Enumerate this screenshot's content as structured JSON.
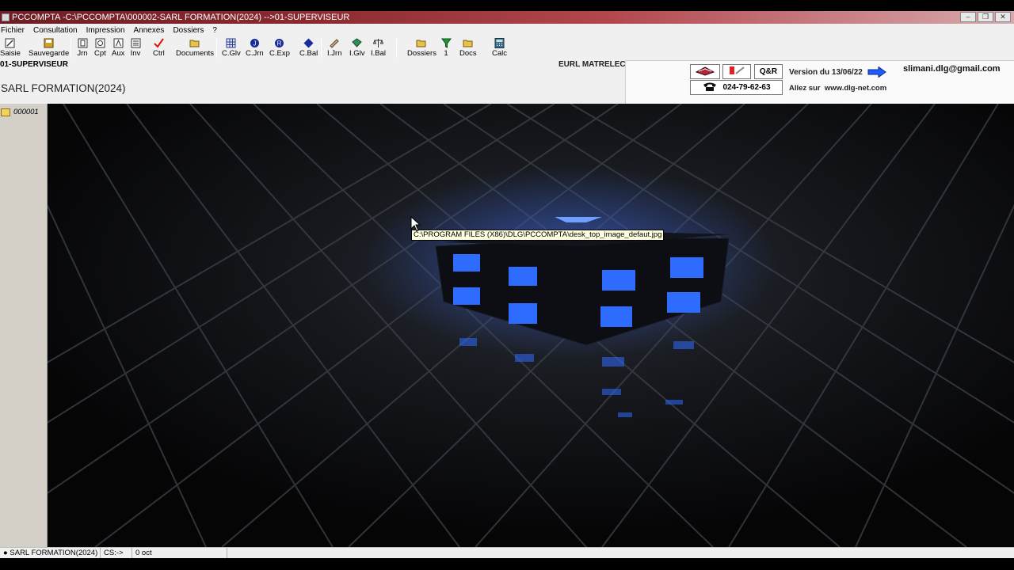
{
  "window": {
    "title": "PCCOMPTA -C:\\PCCOMPTA\\000002-SARL FORMATION(2024) -->01-SUPERVISEUR",
    "controls": [
      "minimize",
      "restore",
      "close"
    ]
  },
  "menu": [
    "Fichier",
    "Consultation",
    "Impression",
    "Annexes",
    "Dossiers",
    "?"
  ],
  "toolbar": {
    "items": [
      {
        "label": "Saisie",
        "icon": "pen-icon"
      },
      {
        "label": "Sauvegarde",
        "icon": "disk-icon"
      },
      {
        "label": "Jrn",
        "icon": "journal-icon"
      },
      {
        "label": "Cpt",
        "icon": "account-icon"
      },
      {
        "label": "Aux",
        "icon": "auxiliary-icon"
      },
      {
        "label": "Inv",
        "icon": "inventory-icon"
      },
      {
        "label": "Ctrl",
        "icon": "checkmark-icon"
      },
      {
        "label": "Documents",
        "icon": "folder-open-icon"
      },
      {
        "label": "C.Glv",
        "icon": "grid-icon"
      },
      {
        "label": "C.Jrn",
        "icon": "circle-j-icon"
      },
      {
        "label": "C.Exp",
        "icon": "circle-r-icon"
      },
      {
        "label": "C.Bal",
        "icon": "diamond-icon"
      },
      {
        "label": "I.Jrn",
        "icon": "pencil-icon"
      },
      {
        "label": "I.Glv",
        "icon": "book-icon"
      },
      {
        "label": "I.Bal",
        "icon": "scales-icon"
      },
      {
        "label": "Dossiers",
        "icon": "folder-open-icon"
      },
      {
        "label": "1",
        "icon": "funnel-icon"
      },
      {
        "label": "Docs",
        "icon": "folder-open-icon"
      },
      {
        "label": "Calc",
        "icon": "calculator-icon"
      }
    ]
  },
  "header": {
    "user": "01-SUPERVISEUR",
    "company": "SARL FORMATION(2024)",
    "client": "EURL MATRELEC",
    "qr_label": "Q&R",
    "phone": "024-79-62-63",
    "version": "Version du 13/06/22",
    "email": "slimani.dlg@gmail.com",
    "visit_prefix": "Allez sur",
    "website": "www.dlg-net.com"
  },
  "sidebar": {
    "folder_label": "000001"
  },
  "desktop": {
    "tooltip": "C:\\PROGRAM FILES (X86)\\DLG\\PCCOMPTA\\desk_top_image_defaut.jpg",
    "accent_color": "#1f5bff"
  },
  "statusbar": {
    "company": "SARL FORMATION(2024)",
    "cs": "CS:->",
    "size": "0 oct"
  }
}
